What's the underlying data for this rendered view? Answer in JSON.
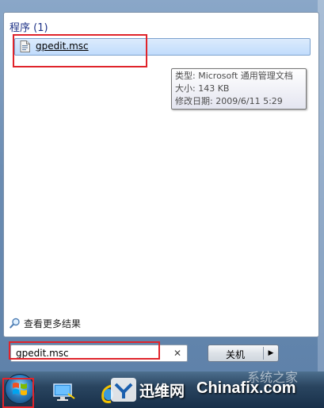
{
  "start_menu": {
    "group_title": "程序 (1)",
    "result": {
      "label": "gpedit.msc"
    },
    "tooltip": {
      "type_line": "类型: Microsoft 通用管理文档",
      "size_line": "大小: 143 KB",
      "modified_line": "修改日期: 2009/6/11 5:29"
    },
    "more_results_label": "查看更多结果",
    "search": {
      "value": "gpedit.msc"
    },
    "shutdown": {
      "label": "关机"
    }
  },
  "watermark": {
    "brand_cn": "迅维网",
    "brand_en": "Chinafix.com",
    "faint": "系统之家"
  },
  "colors": {
    "highlight": "#c1dcfc",
    "annotation_red": "#e0242b",
    "group_title": "#1e3287"
  }
}
